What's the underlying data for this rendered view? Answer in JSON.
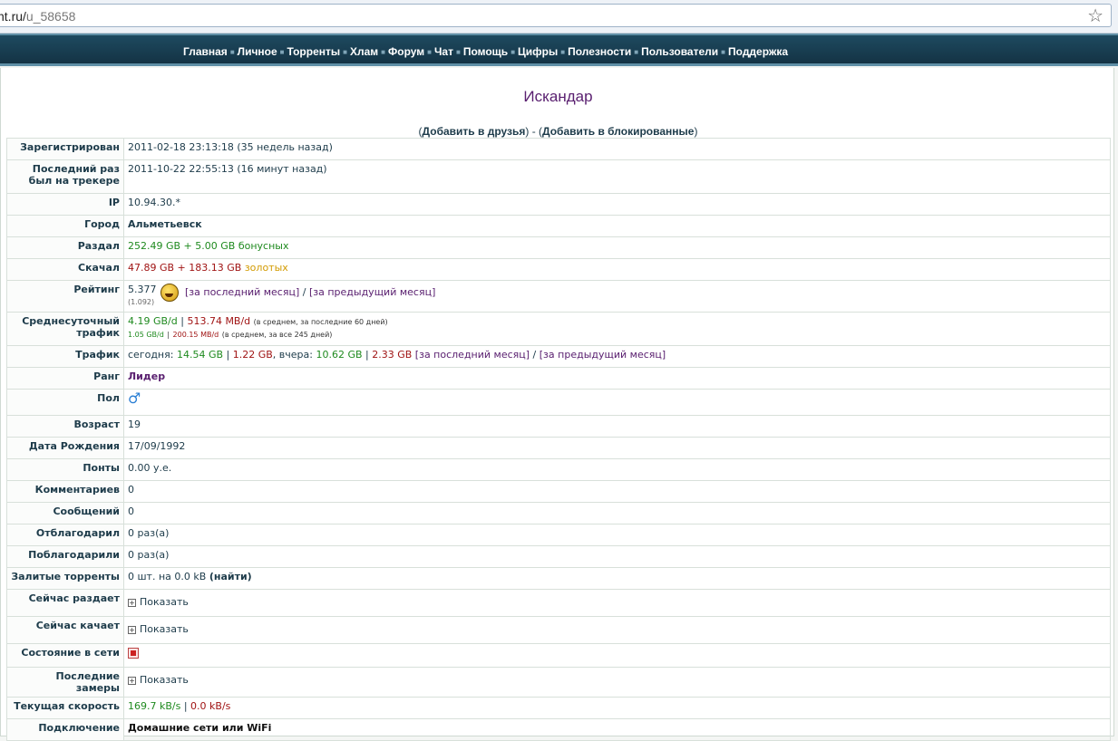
{
  "browser": {
    "url_host": "nt.ru/",
    "url_path": "u_58658",
    "star": "☆"
  },
  "nav": {
    "items": [
      "Главная",
      "Личное",
      "Торренты",
      "Хлам",
      "Форум",
      "Чат",
      "Помощь",
      "Цифры",
      "Полезности",
      "Пользователи",
      "Поддержка"
    ]
  },
  "profile": {
    "username": "Искандар",
    "add_friend": "Добавить в друзья",
    "add_blocked": "Добавить в блокированные"
  },
  "rows": {
    "registered": {
      "label": "Зарегистрирован",
      "value": "2011-02-18 23:13:18 (35 недель назад)"
    },
    "last_seen": {
      "label": "Последний раз был на трекере",
      "value": "2011-10-22 22:55:13 (16 минут назад)"
    },
    "ip": {
      "label": "IP",
      "value": "10.94.30.*"
    },
    "city": {
      "label": "Город",
      "value": "Альметьевск"
    },
    "upload": {
      "label": "Раздал",
      "value": "252.49 GB + 5.00 GB бонусных"
    },
    "download": {
      "label": "Скачал",
      "value_main": "47.89 GB + 183.13 GB",
      "value_gold": "золотых"
    },
    "rating": {
      "label": "Рейтинг",
      "value": "5.377",
      "sub": "(1.092)",
      "month": "[за последний месяц]",
      "sep": "/",
      "prev_month": "[за предыдущий месяц]"
    },
    "daily": {
      "label": "Среднесуточный трафик",
      "line1_up": "4.19 GB/d",
      "line1_down": "513.74 MB/d",
      "line1_note": "(в среднем, за последние 60 дней)",
      "line2_up": "1.05 GB/d",
      "line2_down": "200.15 MB/d",
      "line2_note": "(в среднем, за все 245 дней)"
    },
    "traffic": {
      "label": "Трафик",
      "today_label": "сегодня:",
      "today_up": "14.54 GB",
      "today_down": "1.22 GB",
      "yesterday_label": "вчера:",
      "yesterday_up": "10.62 GB",
      "yesterday_down": "2.33 GB",
      "month": "[за последний месяц]",
      "sep": "/",
      "prev_month": "[за предыдущий месяц]"
    },
    "rank": {
      "label": "Ранг",
      "value": "Лидер"
    },
    "gender": {
      "label": "Пол",
      "icon": "male-icon"
    },
    "age": {
      "label": "Возраст",
      "value": "19"
    },
    "birthday": {
      "label": "Дата Рождения",
      "value": "17/09/1992"
    },
    "points": {
      "label": "Понты",
      "value": "0.00 у.е."
    },
    "comments": {
      "label": "Комментариев",
      "value": "0"
    },
    "messages": {
      "label": "Сообщений",
      "value": "0"
    },
    "thanked": {
      "label": "Отблагодарил",
      "value": "0 раз(а)"
    },
    "was_thanked": {
      "label": "Поблагодарили",
      "value": "0 раз(а)"
    },
    "uploaded_torrents": {
      "label": "Залитые торренты",
      "value": "0 шт. на 0.0 kB",
      "find": "(найти)"
    },
    "seeding": {
      "label": "Сейчас раздает",
      "value": "Показать"
    },
    "leeching": {
      "label": "Сейчас качает",
      "value": "Показать"
    },
    "online": {
      "label": "Состояние в сети",
      "icon": "offline-status-icon"
    },
    "measures": {
      "label": "Последние замеры",
      "value": "Показать"
    },
    "speed": {
      "label": "Текущая скорость",
      "up": "169.7 kB/s",
      "down": "0.0 kB/s"
    },
    "connection": {
      "label": "Подключение",
      "value": "Домашние сети или WiFi"
    }
  }
}
